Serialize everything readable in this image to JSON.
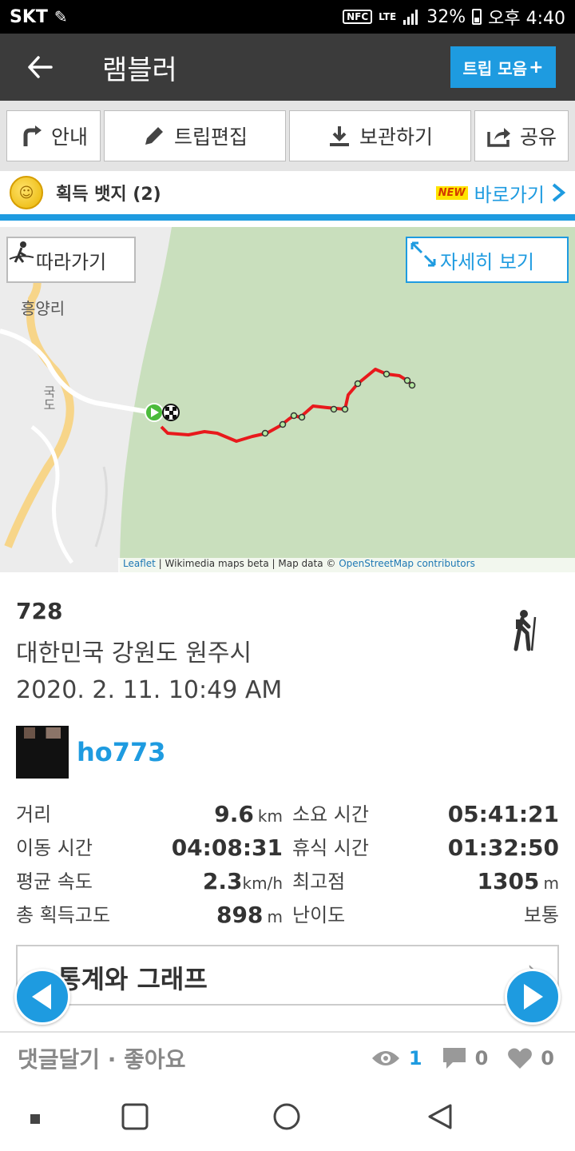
{
  "status_bar": {
    "carrier": "SKT",
    "nfc": "NFC",
    "network": "LTE",
    "battery": "32%",
    "time": "오후 4:40"
  },
  "app_bar": {
    "title": "램블러",
    "trip_button": "트립 모음",
    "trip_button_plus": "+"
  },
  "toolbar": {
    "guide": "안내",
    "edit": "트립편집",
    "save": "보관하기",
    "share": "공유"
  },
  "badge": {
    "label": "획득 뱃지 (2)",
    "new_tag": "NEW",
    "goto": "바로가기"
  },
  "map": {
    "follow_button": "따라가기",
    "detail_button": "자세히 보기",
    "place_label": "흥양리",
    "road_label": "국도",
    "attribution_leaflet": "Leaflet",
    "attribution_mid": " | Wikimedia maps beta | Map data © ",
    "attribution_osm": "OpenStreetMap contributors"
  },
  "trip": {
    "name": "728",
    "location": "대한민국 강원도 원주시",
    "datetime": "2020. 2. 11. 10:49 AM",
    "user": "ho773"
  },
  "stats": {
    "distance_label": "거리",
    "distance_value": "9.6",
    "distance_unit": "km",
    "duration_label": "소요 시간",
    "duration_value": "05:41:21",
    "moving_label": "이동 시간",
    "moving_value": "04:08:31",
    "rest_label": "휴식 시간",
    "rest_value": "01:32:50",
    "speed_label": "평균 속도",
    "speed_value": "2.3",
    "speed_unit": "km/h",
    "max_alt_label": "최고점",
    "max_alt_value": "1305",
    "max_alt_unit": "m",
    "gain_label": "총 획득고도",
    "gain_value": "898",
    "gain_unit": "m",
    "difficulty_label": "난이도",
    "difficulty_value": "보통"
  },
  "graph": {
    "label": "통계와 그래프"
  },
  "social": {
    "comment": "댓글달기 · 좋아요",
    "views": "1",
    "comments": "0",
    "likes": "0"
  },
  "colors": {
    "accent": "#1e9be0",
    "app_bar": "#3b3b3b",
    "route": "#e8191c",
    "map_green": "#c9dfbd"
  }
}
